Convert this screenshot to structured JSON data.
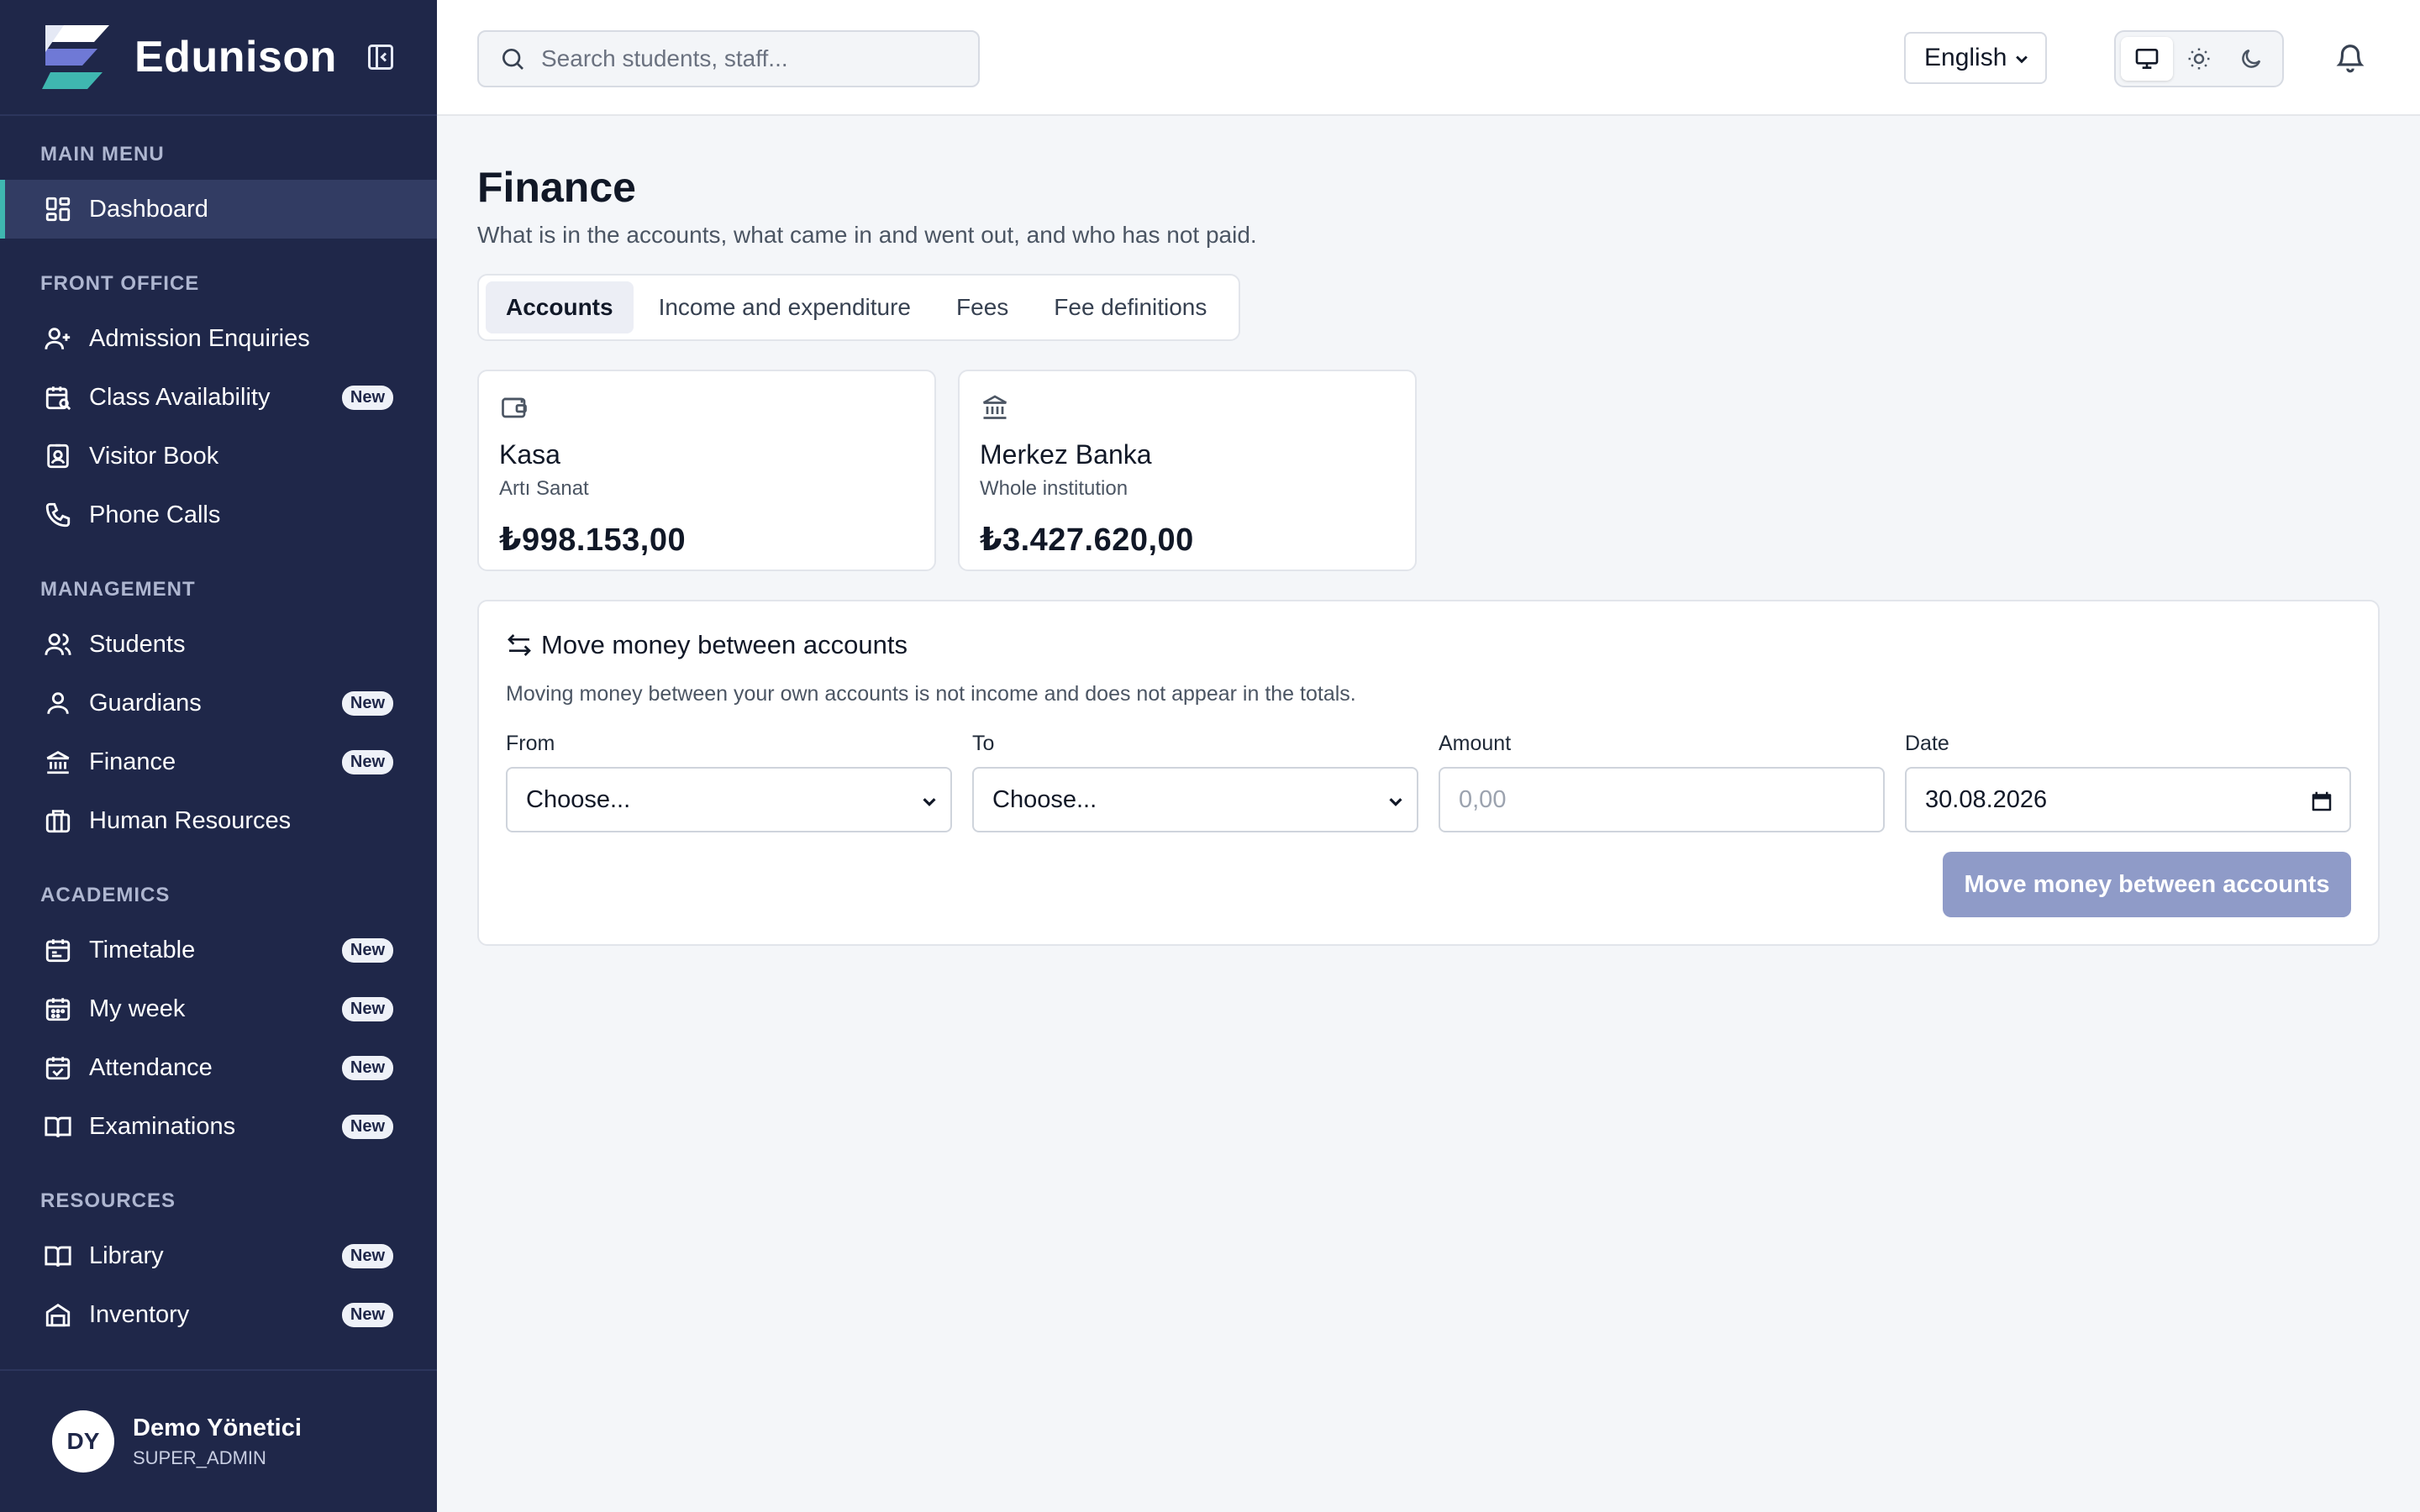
{
  "brand": {
    "name": "Edunison"
  },
  "sidebar": {
    "sections": {
      "main": "MAIN MENU",
      "front": "FRONT OFFICE",
      "management": "MANAGEMENT",
      "academics": "ACADEMICS",
      "resources": "RESOURCES"
    },
    "items": {
      "dashboard": "Dashboard",
      "admission": "Admission Enquiries",
      "class_availability": "Class Availability",
      "visitor_book": "Visitor Book",
      "phone_calls": "Phone Calls",
      "students": "Students",
      "guardians": "Guardians",
      "finance": "Finance",
      "hr": "Human Resources",
      "timetable": "Timetable",
      "my_week": "My week",
      "attendance": "Attendance",
      "examinations": "Examinations",
      "library": "Library",
      "inventory": "Inventory"
    },
    "badge": "New"
  },
  "user": {
    "initials": "DY",
    "name": "Demo Yönetici",
    "role": "SUPER_ADMIN"
  },
  "header": {
    "search_placeholder": "Search students, staff...",
    "language": "English"
  },
  "page": {
    "title": "Finance",
    "subtitle": "What is in the accounts, what came in and went out, and who has not paid."
  },
  "tabs": [
    "Accounts",
    "Income and expenditure",
    "Fees",
    "Fee definitions"
  ],
  "accounts": [
    {
      "name": "Kasa",
      "scope": "Artı Sanat",
      "balance": "₺998.153,00",
      "icon": "wallet-icon"
    },
    {
      "name": "Merkez Banka",
      "scope": "Whole institution",
      "balance": "₺3.427.620,00",
      "icon": "bank-icon"
    }
  ],
  "transfer": {
    "title": "Move money between accounts",
    "note": "Moving money between your own accounts is not income and does not appear in the totals.",
    "from_label": "From",
    "from_value": "Choose...",
    "to_label": "To",
    "to_value": "Choose...",
    "amount_label": "Amount",
    "amount_placeholder": "0,00",
    "date_label": "Date",
    "date_value": "30.08.2026",
    "submit": "Move money between accounts"
  },
  "colors": {
    "sidebar": "#1f2749",
    "accent": "#3fb7b0",
    "button": "#8f9bc8"
  }
}
